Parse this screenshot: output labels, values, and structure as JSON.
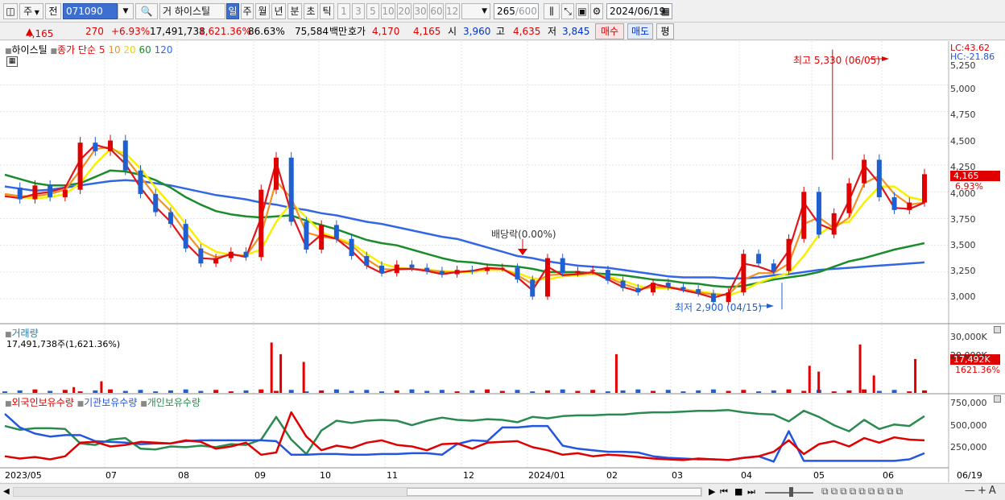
{
  "toolbar": {
    "mode1": "주",
    "mode2": "전",
    "code": "071090",
    "name": "하이스틸",
    "periods": [
      "일",
      "주",
      "월",
      "년",
      "분",
      "초",
      "틱"
    ],
    "minutes": [
      "1",
      "3",
      "5",
      "10",
      "20",
      "30",
      "60",
      "120"
    ],
    "count": "265",
    "count_total": "/600",
    "date": "2024/06/19"
  },
  "info": {
    "price": "4,165",
    "change": "270",
    "pct": "+6.93%",
    "volume": "17,491,738",
    "vol_pct": "1,621.36%",
    "turnover": "86.63%",
    "amount": "75,584",
    "amount_unit": "백만",
    "quote_label": "호가",
    "ask": "4,170",
    "bid": "4,165",
    "open_label": "시",
    "open": "3,960",
    "high_label": "고",
    "high": "4,635",
    "low_label": "저",
    "low": "3,845",
    "buy": "매수",
    "sell": "매도",
    "avg": "평"
  },
  "legend": {
    "name": "하이스틸",
    "ma_label": "종가 단순",
    "ma": [
      "5",
      "10",
      "20",
      "60",
      "120"
    ]
  },
  "price_axis": {
    "ticks": [
      "5,250",
      "5,000",
      "4,750",
      "4,500",
      "4,250",
      "4,000",
      "3,750",
      "3,500",
      "3,250",
      "3,000"
    ],
    "lc": "LC:43.62",
    "hc": "HC:-21.86",
    "last": "4,165",
    "last_pct": "6.93%"
  },
  "annotations": {
    "high": "최고 5,330 (06/05)",
    "low": "최저 2,900 (04/15)",
    "dividend": "배당락(0.00%)"
  },
  "volume_panel": {
    "title": "거래량",
    "value": "17,491,738주(1,621.36%)",
    "ticks": [
      "30,000K",
      "20,000K"
    ],
    "last": "17,492K",
    "last_pct": "1621.36%"
  },
  "holdings_panel": {
    "items": [
      "외국인보유수량",
      "기관보유수량",
      "개인보유수량"
    ],
    "ticks": [
      "750,000",
      "500,000",
      "250,000"
    ]
  },
  "xaxis": {
    "labels": [
      "2023/05",
      "07",
      "08",
      "09",
      "10",
      "11",
      "12",
      "2024/01",
      "02",
      "03",
      "04",
      "05",
      "06",
      "06/19"
    ]
  },
  "colors": {
    "up": "#e00000",
    "down": "#1f5fd0",
    "ma5": "#e0151a",
    "ma10": "#f29222",
    "ma20": "#f8f000",
    "ma60": "#1a8c2c",
    "ma120": "#3366e6",
    "foreign": "#e00000",
    "inst": "#2255e0",
    "indiv": "#2a8a50"
  },
  "chart_data": {
    "type": "candlestick",
    "title": "하이스틸",
    "ylim": [
      2850,
      5380
    ],
    "x_periods": [
      "2023/05",
      "07",
      "08",
      "09",
      "10",
      "11",
      "12",
      "2024/01",
      "02",
      "03",
      "04",
      "05",
      "06"
    ],
    "close": [
      4040,
      3930,
      4060,
      3950,
      4020,
      4460,
      4380,
      4480,
      4200,
      3980,
      3810,
      3700,
      3470,
      3330,
      3380,
      3440,
      3390,
      4020,
      4320,
      3720,
      3460,
      3690,
      3560,
      3400,
      3310,
      3240,
      3320,
      3290,
      3260,
      3230,
      3270,
      3260,
      3290,
      3290,
      3180,
      3020,
      3380,
      3240,
      3260,
      3270,
      3170,
      3100,
      3060,
      3150,
      3110,
      3090,
      3050,
      2970,
      3060,
      3420,
      3330,
      3260,
      3560,
      4000,
      3600,
      3800,
      4080,
      4300,
      3950,
      3830,
      3900,
      4165
    ],
    "ma5": [
      3960,
      3940,
      3980,
      4000,
      4040,
      4300,
      4440,
      4400,
      4260,
      4040,
      3860,
      3720,
      3520,
      3380,
      3370,
      3420,
      3390,
      3760,
      4280,
      3800,
      3480,
      3600,
      3560,
      3450,
      3310,
      3240,
      3280,
      3280,
      3260,
      3230,
      3250,
      3260,
      3290,
      3280,
      3200,
      3080,
      3300,
      3220,
      3230,
      3250,
      3180,
      3110,
      3070,
      3140,
      3110,
      3080,
      3050,
      3010,
      3050,
      3330,
      3300,
      3250,
      3450,
      3900,
      3700,
      3640,
      3920,
      4250,
      4080,
      3850,
      3840,
      3900
    ],
    "ma10": [
      3980,
      3960,
      3960,
      3980,
      4020,
      4200,
      4400,
      4420,
      4320,
      4140,
      3960,
      3820,
      3620,
      3450,
      3390,
      3410,
      3400,
      3600,
      4100,
      3940,
      3620,
      3580,
      3560,
      3500,
      3370,
      3280,
      3270,
      3280,
      3270,
      3250,
      3250,
      3260,
      3280,
      3280,
      3220,
      3140,
      3220,
      3230,
      3230,
      3240,
      3200,
      3140,
      3090,
      3110,
      3110,
      3090,
      3060,
      3040,
      3040,
      3180,
      3240,
      3240,
      3330,
      3700,
      3760,
      3660,
      3760,
      4080,
      4150,
      3980,
      3880,
      3900
    ],
    "ma20": [
      3960,
      3950,
      3940,
      3950,
      3980,
      4080,
      4260,
      4400,
      4360,
      4220,
      4040,
      3880,
      3700,
      3520,
      3440,
      3410,
      3410,
      3460,
      3720,
      3900,
      3760,
      3620,
      3570,
      3520,
      3420,
      3330,
      3290,
      3280,
      3270,
      3260,
      3250,
      3250,
      3270,
      3270,
      3240,
      3190,
      3180,
      3210,
      3220,
      3230,
      3210,
      3170,
      3120,
      3100,
      3100,
      3090,
      3070,
      3050,
      3030,
      3080,
      3150,
      3200,
      3240,
      3400,
      3600,
      3700,
      3720,
      3900,
      4050,
      4050,
      3950,
      3920
    ],
    "ma60": [
      4160,
      4120,
      4080,
      4060,
      4060,
      4080,
      4140,
      4200,
      4190,
      4160,
      4110,
      4040,
      3950,
      3880,
      3820,
      3790,
      3770,
      3760,
      3770,
      3780,
      3730,
      3690,
      3650,
      3600,
      3550,
      3520,
      3500,
      3460,
      3420,
      3380,
      3350,
      3340,
      3320,
      3310,
      3300,
      3280,
      3250,
      3250,
      3250,
      3240,
      3230,
      3220,
      3200,
      3180,
      3170,
      3150,
      3140,
      3120,
      3110,
      3120,
      3150,
      3180,
      3200,
      3220,
      3250,
      3300,
      3350,
      3380,
      3420,
      3460,
      3490,
      3520
    ],
    "ma120": [
      4050,
      4030,
      4010,
      4020,
      4040,
      4060,
      4080,
      4100,
      4110,
      4100,
      4080,
      4060,
      4030,
      4000,
      3970,
      3950,
      3930,
      3900,
      3880,
      3850,
      3830,
      3800,
      3780,
      3750,
      3720,
      3700,
      3670,
      3640,
      3610,
      3580,
      3560,
      3520,
      3480,
      3440,
      3400,
      3380,
      3350,
      3330,
      3310,
      3300,
      3290,
      3270,
      3250,
      3230,
      3210,
      3200,
      3200,
      3200,
      3190,
      3190,
      3200,
      3220,
      3230,
      3250,
      3270,
      3280,
      3290,
      3300,
      3310,
      3320,
      3330,
      3340
    ],
    "high": {
      "value": 5330,
      "date": "06/05"
    },
    "low": {
      "value": 2900,
      "date": "04/15"
    },
    "volume_spikes": [
      {
        "pos": 0.075,
        "v": 3000
      },
      {
        "pos": 0.105,
        "v": 6000
      },
      {
        "pos": 0.325,
        "v": 16000
      },
      {
        "pos": 0.29,
        "v": 26000
      },
      {
        "pos": 0.3,
        "v": 20000
      },
      {
        "pos": 0.665,
        "v": 20000
      },
      {
        "pos": 0.875,
        "v": 14000
      },
      {
        "pos": 0.885,
        "v": 11000
      },
      {
        "pos": 0.93,
        "v": 25000
      },
      {
        "pos": 0.945,
        "v": 9000
      },
      {
        "pos": 0.99,
        "v": 17492
      }
    ],
    "foreign": [
      120,
      90,
      110,
      80,
      120,
      300,
      310,
      250,
      270,
      310,
      300,
      290,
      330,
      310,
      220,
      250,
      300,
      140,
      170,
      700,
      380,
      200,
      260,
      230,
      300,
      330,
      270,
      250,
      200,
      280,
      290,
      220,
      300,
      310,
      320,
      240,
      200,
      140,
      160,
      120,
      140,
      130,
      110,
      90,
      80,
      70,
      90,
      80,
      70,
      100,
      120,
      180,
      330,
      150,
      280,
      320,
      250,
      360,
      300,
      370,
      340,
      330
    ],
    "institution": [
      680,
      500,
      420,
      380,
      400,
      400,
      320,
      310,
      300,
      280,
      290,
      290,
      320,
      330,
      330,
      330,
      330,
      330,
      320,
      140,
      140,
      150,
      150,
      140,
      140,
      150,
      150,
      160,
      160,
      140,
      280,
      330,
      320,
      500,
      500,
      520,
      520,
      260,
      220,
      200,
      180,
      180,
      170,
      120,
      100,
      90,
      80,
      80,
      70,
      100,
      120,
      50,
      450,
      60,
      60,
      60,
      60,
      60,
      60,
      60,
      80,
      160
    ],
    "individual": [
      520,
      470,
      490,
      490,
      480,
      290,
      270,
      340,
      360,
      220,
      210,
      250,
      240,
      260,
      240,
      280,
      270,
      340,
      640,
      340,
      150,
      460,
      590,
      560,
      590,
      600,
      590,
      530,
      590,
      630,
      600,
      590,
      610,
      600,
      570,
      640,
      620,
      650,
      660,
      660,
      670,
      670,
      690,
      700,
      700,
      710,
      720,
      720,
      730,
      700,
      680,
      670,
      580,
      720,
      640,
      530,
      450,
      600,
      480,
      540,
      520,
      650
    ]
  }
}
